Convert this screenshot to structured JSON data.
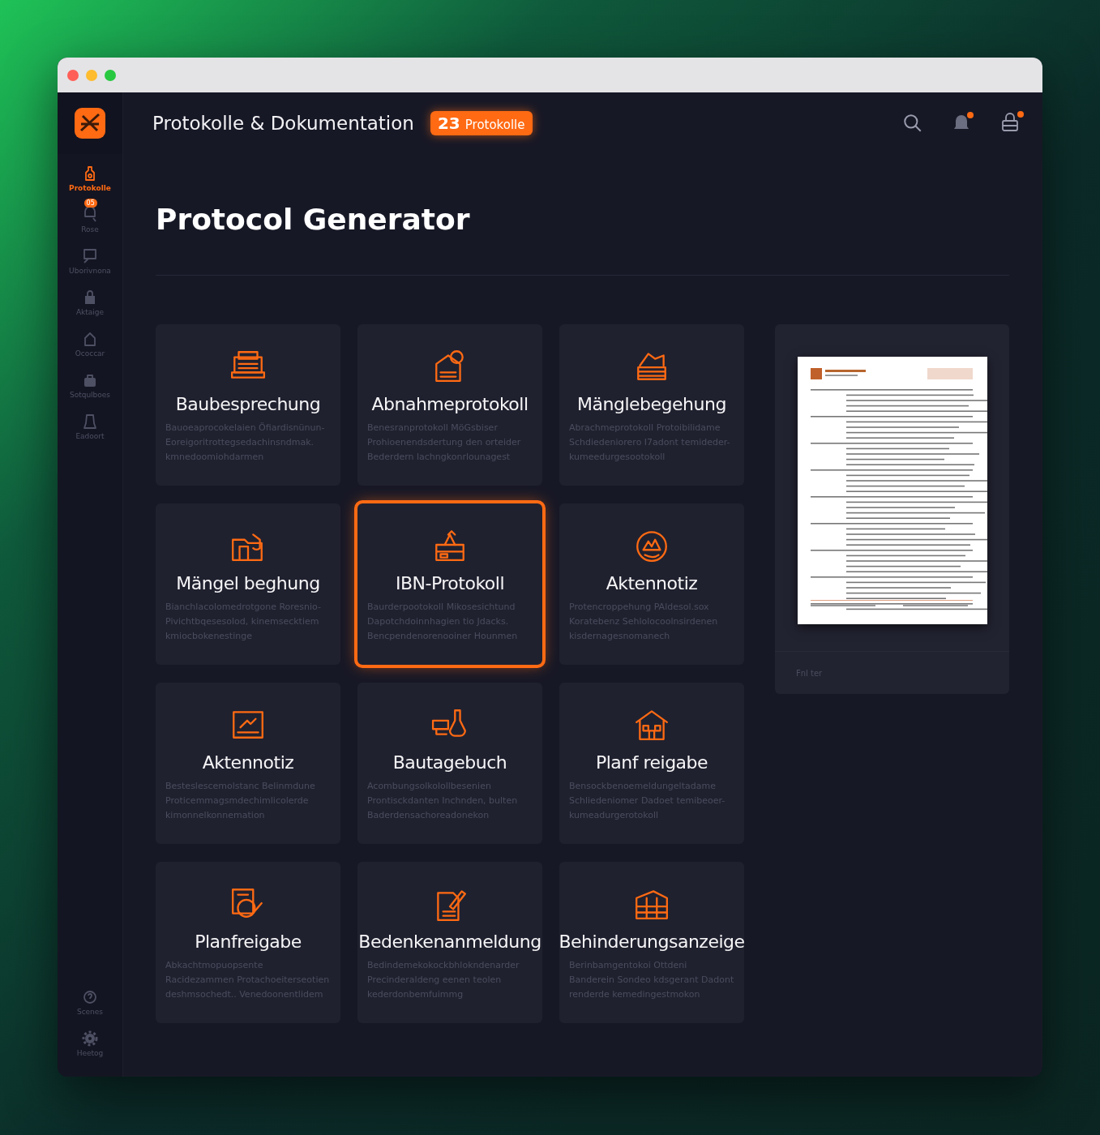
{
  "header": {
    "title": "Protokolle & Dokumentation",
    "badge_count": "23",
    "badge_label": "Protokolle",
    "notification_dot": true,
    "account_dot": true
  },
  "sidebar": {
    "items": [
      {
        "label": "Protokolle",
        "selected": true
      },
      {
        "label": "Rose",
        "selected": false,
        "badge": "05"
      },
      {
        "label": "Uborivnona",
        "selected": false
      },
      {
        "label": "Aktaige",
        "selected": false
      },
      {
        "label": "Ococcar",
        "selected": false
      },
      {
        "label": "Sotqulboes",
        "selected": false
      },
      {
        "label": "Eadoort",
        "selected": false
      }
    ],
    "bottom_items": [
      {
        "label": "Scenes",
        "selected": false
      },
      {
        "label": "Heetog",
        "selected": false
      }
    ]
  },
  "page_title": "Protocol Generator",
  "cards": [
    {
      "title": "Baubesprechung",
      "selected": false,
      "description": "Bauoeaprocokelaien Öfiardisnünun- Eoreigoritrottegsedachinsndmak. kmnedoomiohdarmen"
    },
    {
      "title": "Abnahmeprotokoll",
      "selected": false,
      "description": "Benesranprotokoll MöGsbiser Prohioenendsdertung den orteider Bederdern lachngkonrlounagest"
    },
    {
      "title": "Mänglebegehung",
      "selected": false,
      "description": "Abrachmeprotokoll Protoibilidame Schdiedeniorero I7adont temideder- kumeedurgesootokoll"
    },
    {
      "title": "Mängel beghung",
      "selected": false,
      "description": "Bianchlacolomedrotgone Roresnio- Pivichtbqesesolod, kinemsecktiem kmiocbokenestinge"
    },
    {
      "title": "IBN-Protokoll",
      "selected": true,
      "description": "Baurderpootokoll Mikosesichtund Dapotchdoinnhagien tio Jdacks. Bencpendenorenooiner Hounmen"
    },
    {
      "title": "Aktennotiz",
      "selected": false,
      "description": "Protencroppehung PAldesol.sox Koratebenz Sehlolocoolnsirdenen kisdernagesnomanech"
    },
    {
      "title": "Aktennotiz",
      "selected": false,
      "description": "Besteslescemolstanc Belinmdune Proticemmagsmdechimlicolerde kimonnelkonnemation"
    },
    {
      "title": "Bautagebuch",
      "selected": false,
      "description": "Acombungsolkolollbesenien Prontisckdanten Inchnden, bulten Baderdensachoreadonekon"
    },
    {
      "title": "Planf reigabe",
      "selected": false,
      "description": "Bensockbenoemeldungeltadame Schliedeniomer Dadoet temibeoer- kumeadurgerotokoll"
    },
    {
      "title": "Planfreigabe",
      "selected": false,
      "description": "Abkachtmopuopsente Racidezammen Protachoeiterseotien deshmsochedt.. Venedoonentlidem"
    },
    {
      "title": "Bedenkenanmeldung",
      "selected": false,
      "description": "Bedindemekokockbhlokndenarder Precinderaldeng eenen teolen kederdonbemfuimmg"
    },
    {
      "title": "Behinderungsanzeige",
      "selected": false,
      "description": "Berinbamgentokoi Ottdeni Banderein Sondeo kdsgerant Dadont renderde kemedingestmokon"
    }
  ],
  "preview": {
    "caption": "Fnl ter"
  }
}
